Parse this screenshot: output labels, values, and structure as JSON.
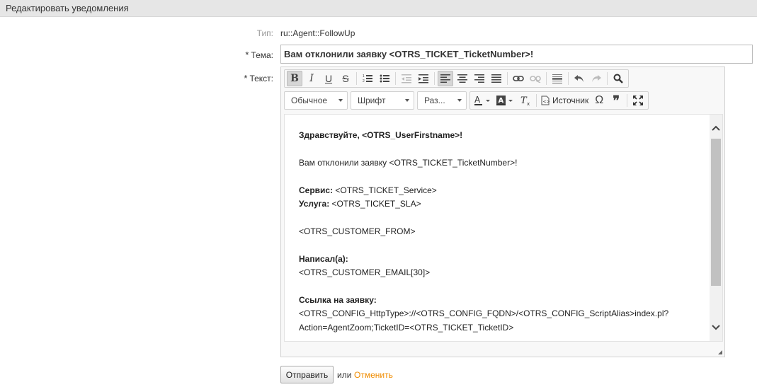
{
  "header": {
    "title": "Редактировать уведомления"
  },
  "form": {
    "type_label": "Тип:",
    "type_value": "ru::Agent::FollowUp",
    "subject_label": "Тема:",
    "subject_value": "Вам отклонили заявку <OTRS_TICKET_TicketNumber>!",
    "text_label": "Текст:",
    "required_mark": "*"
  },
  "toolbar": {
    "format_combo": "Обычное",
    "font_combo": "Шрифт",
    "size_combo": "Раз...",
    "source_label": "Источник"
  },
  "body": {
    "greeting": "Здравствуйте, <OTRS_UserFirstname>!",
    "line_rejected": "Вам отклонили заявку <OTRS_TICKET_TicketNumber>!",
    "service_label": "Сервис:",
    "service_value": " <OTRS_TICKET_Service>",
    "sla_label": "Услуга:",
    "sla_value": " <OTRS_TICKET_SLA>",
    "customer_from": "<OTRS_CUSTOMER_FROM>",
    "wrote_label": "Написал(а):",
    "customer_email": "<OTRS_CUSTOMER_EMAIL[30]>",
    "link_label": "Ссылка на заявку:",
    "link_line1": "<OTRS_CONFIG_HttpType>://<OTRS_CONFIG_FQDN>/<OTRS_CONFIG_ScriptAlias>index.pl?",
    "link_line2": "Action=AgentZoom;TicketID=<OTRS_TICKET_TicketID>"
  },
  "actions": {
    "submit_label": "Отправить",
    "or_text": "или",
    "cancel_label": "Отменить"
  }
}
